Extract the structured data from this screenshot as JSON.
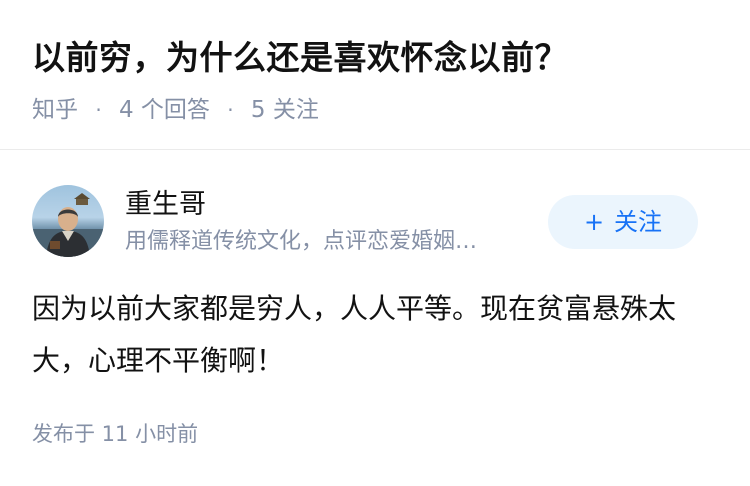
{
  "question": {
    "title": "以前穷，为什么还是喜欢怀念以前？",
    "source": "知乎",
    "answers_count": "4 个回答",
    "followers_count": "5 关注",
    "separator": "·"
  },
  "answer": {
    "author": {
      "name": "重生哥",
      "bio": "用儒释道传统文化，点评恋爱婚姻…",
      "avatar_icon": "person-avatar"
    },
    "follow_button": {
      "plus": "+",
      "label": "关注"
    },
    "content": "因为以前大家都是穷人，人人平等。现在贫富悬殊太大，心理不平衡啊！",
    "published": "发布于 11 小时前"
  },
  "colors": {
    "text_primary": "#121212",
    "text_secondary": "#8590a6",
    "accent": "#1772f6",
    "follow_bg": "#ebf5fd"
  }
}
